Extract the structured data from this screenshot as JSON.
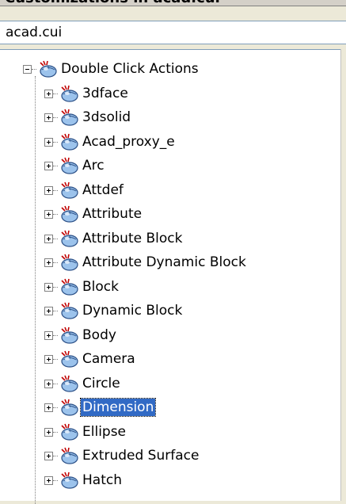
{
  "panel": {
    "title": "Customizations in acad.cui"
  },
  "file_combo": {
    "value": "acad.cui"
  },
  "tree": {
    "root": {
      "label": "Double Click Actions",
      "icon": "mouse-action-icon",
      "expanded": true
    },
    "children": [
      {
        "label": "3dface",
        "icon": "mouse-action-icon"
      },
      {
        "label": "3dsolid",
        "icon": "mouse-action-icon"
      },
      {
        "label": "Acad_proxy_e",
        "icon": "mouse-action-icon"
      },
      {
        "label": "Arc",
        "icon": "mouse-action-icon"
      },
      {
        "label": "Attdef",
        "icon": "mouse-action-icon"
      },
      {
        "label": "Attribute",
        "icon": "mouse-action-icon"
      },
      {
        "label": "Attribute Block",
        "icon": "mouse-action-icon"
      },
      {
        "label": "Attribute Dynamic Block",
        "icon": "mouse-action-icon"
      },
      {
        "label": "Block",
        "icon": "mouse-action-icon"
      },
      {
        "label": "Dynamic Block",
        "icon": "mouse-action-icon"
      },
      {
        "label": "Body",
        "icon": "mouse-action-icon"
      },
      {
        "label": "Camera",
        "icon": "mouse-action-icon"
      },
      {
        "label": "Circle",
        "icon": "mouse-action-icon"
      },
      {
        "label": "Dimension",
        "icon": "mouse-action-icon",
        "selected": true
      },
      {
        "label": "Ellipse",
        "icon": "mouse-action-icon"
      },
      {
        "label": "Extruded Surface",
        "icon": "mouse-action-icon"
      },
      {
        "label": "Hatch",
        "icon": "mouse-action-icon"
      }
    ]
  },
  "colors": {
    "selection": "#316ac5",
    "tree_bg": "#ffffff",
    "chrome": "#ece9d8"
  }
}
